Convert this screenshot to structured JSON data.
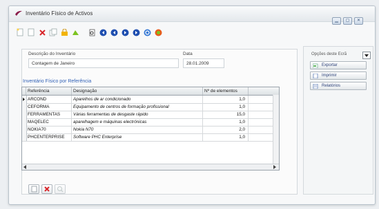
{
  "window": {
    "title": "Inventário Físico de Activos"
  },
  "form": {
    "descricao_label": "Descrição do Inventário",
    "descricao_value": "Contagem de Janeiro",
    "data_label": "Data",
    "data_value": "28.01.2009"
  },
  "grid": {
    "section_title": "Inventário Físico por Referência",
    "columns": [
      "Referência",
      "Designação",
      "Nº de elementos"
    ],
    "rows": [
      {
        "ref": "ARCOND",
        "desc": "Aparelhos de ar condicionado",
        "qty": "1,0"
      },
      {
        "ref": "CEFORMA",
        "desc": "Equipamento de centros de formação profissional",
        "qty": "1,0"
      },
      {
        "ref": "FERRAMENTAS",
        "desc": "Várias ferramentas de desgaste rápido",
        "qty": "15,0"
      },
      {
        "ref": "MAQELEC",
        "desc": "aparelhagem e máquinas electrónicas",
        "qty": "1,0"
      },
      {
        "ref": "NOKIA70",
        "desc": "Nokia N70",
        "qty": "2,0"
      },
      {
        "ref": "PHCENTERPRISE",
        "desc": "Software PHC Enterprise",
        "qty": "1,0"
      }
    ]
  },
  "sidebar": {
    "options_label": "Opções deste Ecrã",
    "actions": [
      "Exportar",
      "Imprimir",
      "Relatórios"
    ]
  },
  "icons": {
    "toolbar": [
      "new-icon",
      "delete-icon",
      "copy-icon",
      "lock-icon",
      "attach-icon",
      "print-preview-icon",
      "nav-first-icon",
      "nav-prev-icon",
      "nav-next-icon",
      "nav-last-icon",
      "refresh-icon",
      "help-icon"
    ],
    "bottom": [
      "new-row-icon",
      "delete-row-icon",
      "search-row-icon"
    ]
  },
  "colors": {
    "accent": "#2f5fb5",
    "delete_red": "#d8262b",
    "nav_blue": "#1f4fb0"
  }
}
